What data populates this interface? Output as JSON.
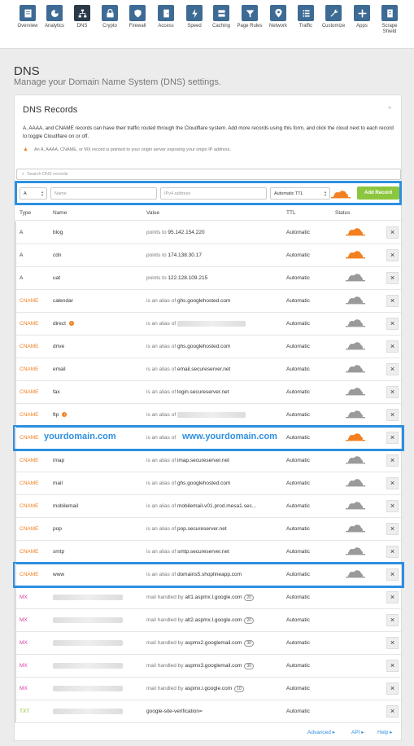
{
  "nav": [
    {
      "label": "Overview",
      "icon": "overview-icon"
    },
    {
      "label": "Analytics",
      "icon": "analytics-icon"
    },
    {
      "label": "DNS",
      "icon": "dns-icon",
      "active": true
    },
    {
      "label": "Crypto",
      "icon": "lock-icon"
    },
    {
      "label": "Firewall",
      "icon": "shield-icon"
    },
    {
      "label": "Access",
      "icon": "door-icon"
    },
    {
      "label": "Speed",
      "icon": "lightning-icon"
    },
    {
      "label": "Caching",
      "icon": "server-icon"
    },
    {
      "label": "Page Rules",
      "icon": "filter-icon"
    },
    {
      "label": "Network",
      "icon": "location-pin-icon"
    },
    {
      "label": "Traffic",
      "icon": "list-icon"
    },
    {
      "label": "Customize",
      "icon": "wrench-icon"
    },
    {
      "label": "Apps",
      "icon": "plus-icon"
    },
    {
      "label": "Scrape Shield",
      "icon": "document-icon"
    }
  ],
  "page": {
    "title": "DNS",
    "subtitle": "Manage your Domain Name System (DNS) settings."
  },
  "card": {
    "title": "DNS Records",
    "description": "A, AAAA, and CNAME records can have their traffic routed through the Cloudflare system. Add more records using this form, and click the cloud next to each record to toggle Cloudflare on or off.",
    "warning": "An A, AAAA, CNAME, or MX record is pointed to your origin server exposing your origin IP address.",
    "search_placeholder": "Search DNS records"
  },
  "add_form": {
    "type": "A",
    "name_placeholder": "Name",
    "value_placeholder": "IPv4 address",
    "ttl": "Automatic TTL",
    "button": "Add Record"
  },
  "columns": {
    "type": "Type",
    "name": "Name",
    "value": "Value",
    "ttl": "TTL",
    "status": "Status"
  },
  "records": [
    {
      "type": "A",
      "name": "blog",
      "prefix": "points to",
      "value": "95.142.154.220",
      "ttl": "Automatic",
      "proxied": true
    },
    {
      "type": "A",
      "name": "cdn",
      "prefix": "points to",
      "value": "174.138.30.17",
      "ttl": "Automatic",
      "proxied": true
    },
    {
      "type": "A",
      "name": "uat",
      "prefix": "points to",
      "value": "122.128.109.215",
      "ttl": "Automatic",
      "proxied": false
    },
    {
      "type": "CNAME",
      "name": "calendar",
      "prefix": "is an alias of",
      "value": "ghs.googlehosted.com",
      "ttl": "Automatic",
      "proxied": false
    },
    {
      "type": "CNAME",
      "name": "direct",
      "prefix": "is an alias of",
      "value": "",
      "ttl": "Automatic",
      "proxied": false,
      "info": true,
      "blurred_value": true
    },
    {
      "type": "CNAME",
      "name": "drive",
      "prefix": "is an alias of",
      "value": "ghs.googlehosted.com",
      "ttl": "Automatic",
      "proxied": false
    },
    {
      "type": "CNAME",
      "name": "email",
      "prefix": "is an alias of",
      "value": "email.secureserver.net",
      "ttl": "Automatic",
      "proxied": false
    },
    {
      "type": "CNAME",
      "name": "fax",
      "prefix": "is an alias of",
      "value": "login.secureserver.net",
      "ttl": "Automatic",
      "proxied": false
    },
    {
      "type": "CNAME",
      "name": "ftp",
      "prefix": "is an alias of",
      "value": "",
      "ttl": "Automatic",
      "proxied": false,
      "info": true,
      "blurred_value": true
    },
    {
      "type": "CNAME",
      "name": "",
      "prefix": "is an alias of",
      "value": "",
      "ttl": "Automatic",
      "proxied": true,
      "highlight": true,
      "overlay_name": "yourdomain.com",
      "overlay_value": "www.yourdomain.com"
    },
    {
      "type": "CNAME",
      "name": "imap",
      "prefix": "is an alias of",
      "value": "imap.secureserver.net",
      "ttl": "Automatic",
      "proxied": false
    },
    {
      "type": "CNAME",
      "name": "mail",
      "prefix": "is an alias of",
      "value": "ghs.googlehosted.com",
      "ttl": "Automatic",
      "proxied": false
    },
    {
      "type": "CNAME",
      "name": "mobilemail",
      "prefix": "is an alias of",
      "value": "mobilemail-v01.prod.mesa1.sec...",
      "ttl": "Automatic",
      "proxied": false
    },
    {
      "type": "CNAME",
      "name": "pop",
      "prefix": "is an alias of",
      "value": "pop.secureserver.net",
      "ttl": "Automatic",
      "proxied": false
    },
    {
      "type": "CNAME",
      "name": "smtp",
      "prefix": "is an alias of",
      "value": "smtp.secureserver.net",
      "ttl": "Automatic",
      "proxied": false
    },
    {
      "type": "CNAME",
      "name": "www",
      "prefix": "is an alias of",
      "value": "domains5.shoplineapp.com",
      "ttl": "Automatic",
      "proxied": false,
      "highlight": true
    },
    {
      "type": "MX",
      "name": "",
      "prefix": "mail handled by",
      "value": "alt1.aspmx.l.google.com",
      "priority": "20",
      "ttl": "Automatic",
      "blurred_name": true
    },
    {
      "type": "MX",
      "name": "",
      "prefix": "mail handled by",
      "value": "alt2.aspmx.l.google.com",
      "priority": "20",
      "ttl": "Automatic",
      "blurred_name": true
    },
    {
      "type": "MX",
      "name": "",
      "prefix": "mail handled by",
      "value": "aspmx2.googlemail.com",
      "priority": "30",
      "ttl": "Automatic",
      "blurred_name": true
    },
    {
      "type": "MX",
      "name": "",
      "prefix": "mail handled by",
      "value": "aspmx3.googlemail.com",
      "priority": "30",
      "ttl": "Automatic",
      "blurred_name": true
    },
    {
      "type": "MX",
      "name": "",
      "prefix": "mail handled by",
      "value": "aspmx.l.google.com",
      "priority": "10",
      "ttl": "Automatic",
      "blurred_name": true
    },
    {
      "type": "TXT",
      "name": "",
      "prefix": "",
      "value": "google-site-verification=",
      "ttl": "Automatic",
      "blurred_name": true
    }
  ],
  "footer": {
    "advanced": "Advanced ▸",
    "api": "API ▸",
    "help": "Help ▸"
  },
  "colors": {
    "accent": "#2d8fe0",
    "cloud_on": "#f38020",
    "cloud_off": "#9a9a9a",
    "add_button": "#8cc63f"
  }
}
